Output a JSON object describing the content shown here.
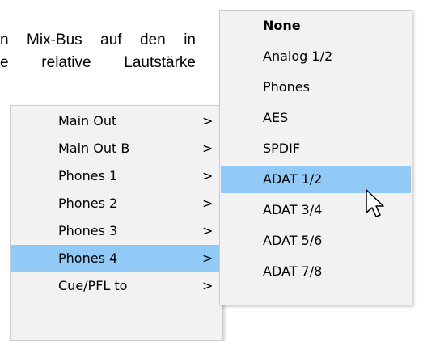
{
  "document": {
    "line1": "n Mix-Bus auf den in",
    "line2": "e relative Lautstärke"
  },
  "main_menu": {
    "items": [
      {
        "label": "Main Out",
        "arrow": ">"
      },
      {
        "label": "Main Out B",
        "arrow": ">"
      },
      {
        "label": "Phones 1",
        "arrow": ">"
      },
      {
        "label": "Phones 2",
        "arrow": ">"
      },
      {
        "label": "Phones 3",
        "arrow": ">"
      },
      {
        "label": "Phones 4",
        "arrow": ">",
        "selected": true
      },
      {
        "label": "Cue/PFL to",
        "arrow": ">"
      }
    ]
  },
  "sub_menu": {
    "items": [
      {
        "label": "None"
      },
      {
        "label": "Analog 1/2"
      },
      {
        "label": "Phones"
      },
      {
        "label": "AES"
      },
      {
        "label": "SPDIF"
      },
      {
        "label": "ADAT 1/2",
        "selected": true
      },
      {
        "label": "ADAT 3/4"
      },
      {
        "label": "ADAT 5/6"
      },
      {
        "label": "ADAT 7/8"
      }
    ]
  },
  "colors": {
    "menu_bg": "#f2f2f2",
    "highlight": "#91c9f7",
    "border": "#cccccc"
  },
  "icons": {
    "cursor": "mouse-pointer-icon"
  }
}
